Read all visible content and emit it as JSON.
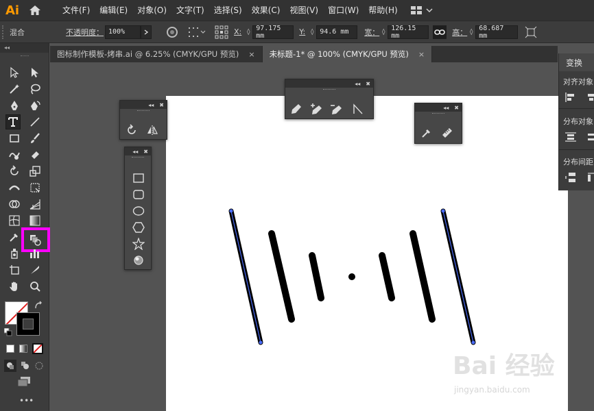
{
  "app": {
    "logo": "Ai"
  },
  "menu": [
    "文件(F)",
    "编辑(E)",
    "对象(O)",
    "文字(T)",
    "选择(S)",
    "效果(C)",
    "视图(V)",
    "窗口(W)",
    "帮助(H)"
  ],
  "control": {
    "mode_label": "混合",
    "opacity_label": "不透明度：",
    "opacity_value": "100%",
    "x_label": "X:",
    "x_value": "97.175 mm",
    "y_label": "Y:",
    "y_value": "94.6 mm",
    "w_label": "宽：",
    "w_value": "126.15 mm",
    "h_label": "高：",
    "h_value": "68.687 mm"
  },
  "tabs": [
    {
      "label": "图标制作模板-烤串.ai @ 6.25% (CMYK/GPU 预览)",
      "close": "×"
    },
    {
      "label": "未标题-1* @ 100% (CMYK/GPU 预览)",
      "close": "×"
    }
  ],
  "right_panel": {
    "tab": "变换",
    "align_objects": "对齐对象",
    "distribute_objects": "分布对象",
    "distribute_spacing": "分布间距"
  },
  "watermark": {
    "brand": "Bai 经验",
    "url": "jingyan.baidu.com"
  },
  "colors": {
    "accent_highlight": "#ff00ff",
    "selection": "#4a6cf7",
    "app_logo": "#ff9a00"
  }
}
